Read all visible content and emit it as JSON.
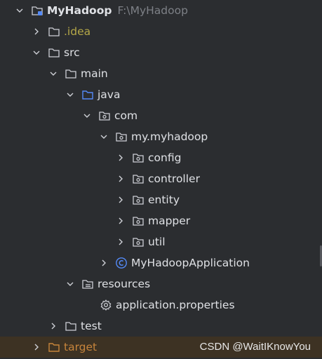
{
  "project": {
    "name": "MyHadoop",
    "path": "F:\\MyHadoop"
  },
  "tree": {
    "idea": ".idea",
    "src": "src",
    "main": "main",
    "java": "java",
    "com": "com",
    "my_myhadoop": "my.myhadoop",
    "config": "config",
    "controller": "controller",
    "entity": "entity",
    "mapper": "mapper",
    "util": "util",
    "app_class": "MyHadoopApplication",
    "resources": "resources",
    "app_properties": "application.properties",
    "test": "test",
    "target": "target"
  },
  "colors": {
    "background": "#2b2d30",
    "text": "#dfe1e5",
    "idea_text": "#b5a848",
    "target_text": "#c7843b",
    "target_row_bg": "#3d3223",
    "java_folder": "#548af7",
    "class_icon": "#548af7"
  },
  "watermark": "CSDN @WaitIKnowYou"
}
